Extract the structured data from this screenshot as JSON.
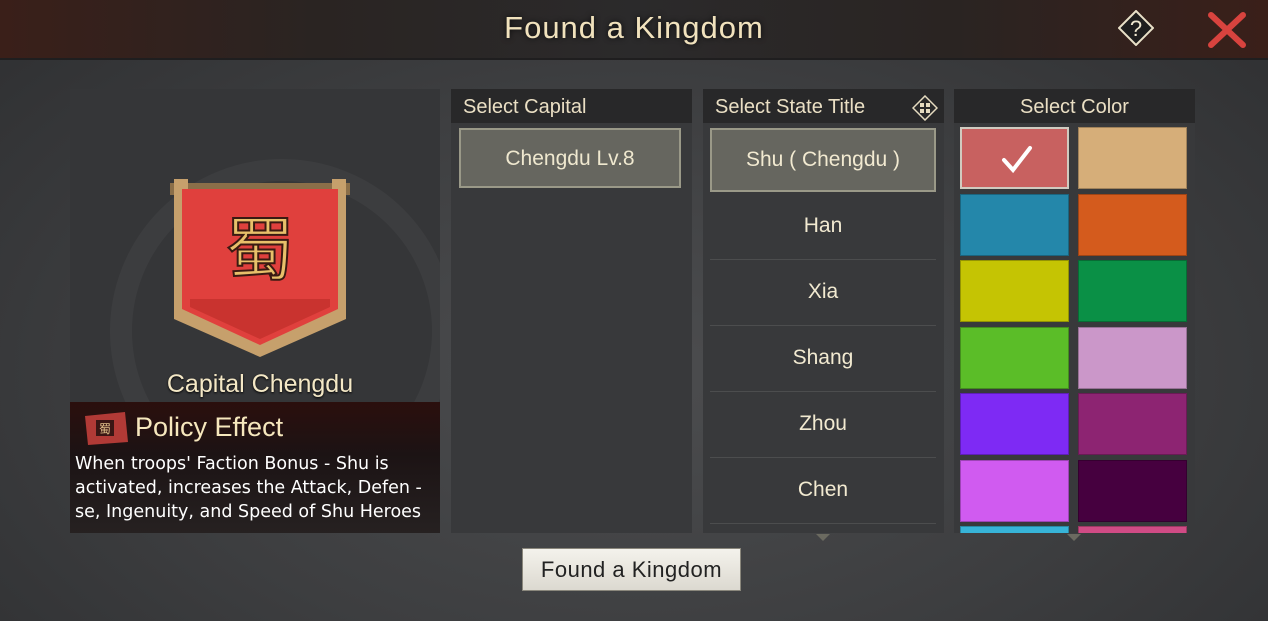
{
  "header": {
    "title": "Found a Kingdom"
  },
  "left_panel": {
    "capital_label": "Capital Chengdu",
    "policy_title": "Policy Effect",
    "policy_description": "When troops' Faction Bonus - Shu is activated, increases the Attack, Defen -se, Ingenuity, and Speed of Shu Heroes",
    "banner_color": "#e0403d"
  },
  "capital_column": {
    "header": "Select Capital",
    "items": [
      "Chengdu Lv.8"
    ]
  },
  "state_title_column": {
    "header": "Select State Title",
    "items": [
      "Shu ( Chengdu )",
      "Han",
      "Xia",
      "Shang",
      "Zhou",
      "Chen"
    ],
    "selected_index": 0
  },
  "color_column": {
    "header": "Select Color",
    "selected_index": 0,
    "colors": [
      "#c86160",
      "#d6ae79",
      "#2487aa",
      "#d45b1d",
      "#c5c403",
      "#0a9046",
      "#5bbd28",
      "#cb97c9",
      "#7e2af4",
      "#8d2472",
      "#d05bf0",
      "#46003f",
      "#37b4d8",
      "#d04b85"
    ]
  },
  "footer": {
    "found_button_label": "Found a Kingdom"
  }
}
